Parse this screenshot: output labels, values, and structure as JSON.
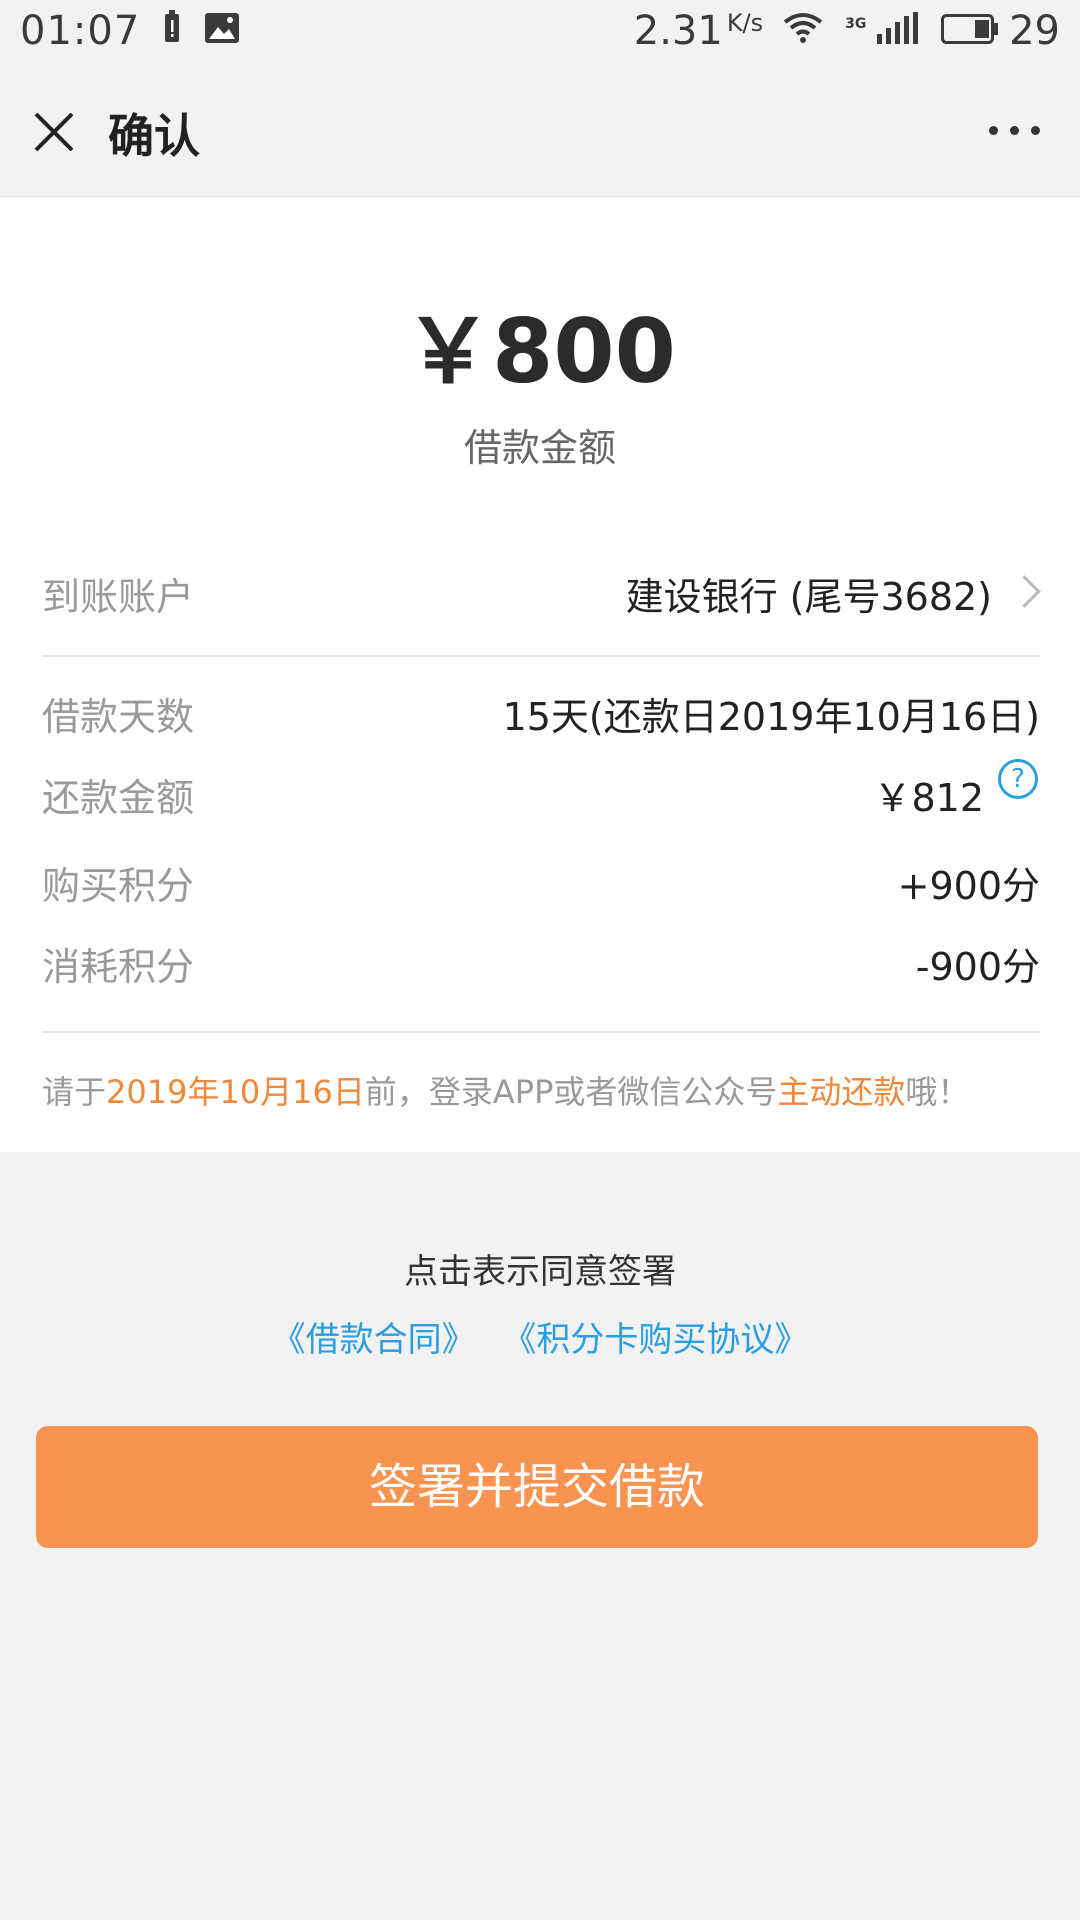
{
  "status_bar": {
    "time": "01:07",
    "speed": "2.31",
    "speed_unit": "K/s",
    "network": "3G",
    "battery": "29",
    "icons": [
      "battery-alert-icon",
      "image-icon",
      "wifi-icon",
      "signal-icon",
      "battery-icon"
    ]
  },
  "nav": {
    "title": "确认",
    "close_icon": "close-icon",
    "more_icon": "more-icon"
  },
  "loan": {
    "amount": "￥800",
    "amount_label": "借款金额"
  },
  "rows": {
    "account": {
      "label": "到账账户",
      "value": "建设银行 (尾号3682)"
    },
    "days": {
      "label": "借款天数",
      "value": "15天(还款日2019年10月16日)"
    },
    "repay": {
      "label": "还款金额",
      "value": "￥812",
      "help": "?"
    },
    "buy_points": {
      "label": "购买积分",
      "value": "+900分"
    },
    "use_points": {
      "label": "消耗积分",
      "value": "-900分"
    }
  },
  "tip": {
    "prefix": "请于",
    "date": "2019年10月16日",
    "middle": "前，登录APP或者微信公众号",
    "action": "主动还款",
    "suffix": "哦！"
  },
  "agreement": {
    "text": "点击表示同意签署",
    "contract": "《借款合同》",
    "points_card": "《积分卡购买协议》"
  },
  "submit_label": "签署并提交借款",
  "colors": {
    "accent_orange": "#f99350",
    "link_blue": "#2a9ee0",
    "highlight_orange": "#f0883a"
  }
}
